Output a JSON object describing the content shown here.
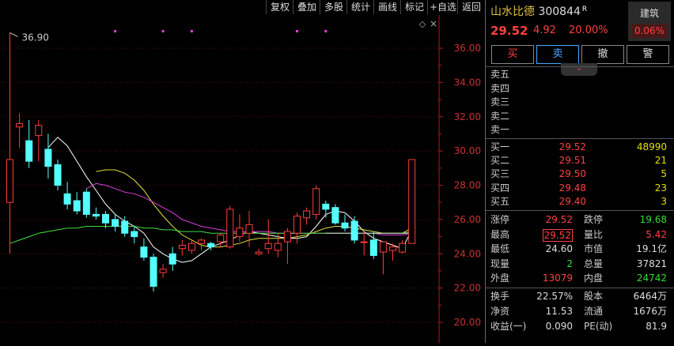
{
  "toolbar": {
    "buttons": [
      "复权",
      "叠加",
      "多股",
      "统计",
      "画线",
      "标记",
      "+自选",
      "返回"
    ]
  },
  "chart": {
    "y_ticks": [
      "36.00",
      "34.00",
      "32.00",
      "30.00",
      "28.00",
      "26.00",
      "24.00",
      "22.00",
      "20.00"
    ],
    "high_marker": "36.90",
    "diamond": "◇",
    "close_x": "×"
  },
  "chart_data": {
    "type": "candlestick",
    "ylim": [
      19.3,
      37.6
    ],
    "y_ticks": [
      36,
      34,
      32,
      30,
      28,
      26,
      24,
      22,
      20
    ],
    "candles": [
      [
        27.0,
        36.9,
        24.0,
        29.5
      ],
      [
        31.4,
        32.2,
        30.2,
        31.6
      ],
      [
        30.6,
        31.8,
        29.0,
        29.4
      ],
      [
        30.9,
        31.8,
        29.4,
        31.5
      ],
      [
        30.1,
        31.0,
        28.4,
        29.1
      ],
      [
        29.2,
        29.5,
        27.7,
        28.0
      ],
      [
        27.5,
        28.2,
        26.6,
        26.9
      ],
      [
        27.1,
        27.6,
        26.3,
        26.5
      ],
      [
        27.6,
        27.8,
        26.1,
        26.3
      ],
      [
        26.3,
        26.7,
        26.0,
        26.2
      ],
      [
        26.3,
        26.5,
        25.5,
        25.8
      ],
      [
        26.0,
        26.3,
        25.3,
        25.6
      ],
      [
        25.9,
        26.2,
        25.0,
        25.2
      ],
      [
        25.3,
        25.6,
        24.6,
        25.0
      ],
      [
        24.4,
        24.9,
        23.6,
        23.8
      ],
      [
        23.8,
        24.0,
        21.8,
        22.1
      ],
      [
        22.9,
        23.4,
        22.6,
        23.1
      ],
      [
        24.0,
        24.4,
        23.0,
        23.4
      ],
      [
        24.3,
        24.8,
        23.9,
        24.5
      ],
      [
        24.2,
        24.8,
        24.0,
        24.6
      ],
      [
        24.6,
        24.9,
        24.2,
        24.8
      ],
      [
        24.6,
        24.7,
        24.2,
        24.4
      ],
      [
        24.7,
        25.2,
        24.4,
        25.1
      ],
      [
        24.4,
        26.8,
        24.3,
        26.6
      ],
      [
        25.0,
        26.3,
        24.7,
        25.5
      ],
      [
        25.2,
        26.5,
        24.4,
        25.7
      ],
      [
        24.0,
        24.3,
        23.9,
        24.1
      ],
      [
        24.3,
        26.0,
        24.0,
        24.6
      ],
      [
        24.2,
        25.2,
        23.8,
        24.6
      ],
      [
        24.7,
        25.5,
        23.4,
        25.3
      ],
      [
        25.2,
        26.4,
        24.6,
        26.2
      ],
      [
        26.1,
        26.7,
        25.7,
        26.5
      ],
      [
        26.3,
        28.0,
        26.0,
        27.8
      ],
      [
        26.9,
        27.1,
        26.1,
        26.6
      ],
      [
        26.7,
        26.9,
        25.7,
        25.8
      ],
      [
        25.8,
        26.3,
        25.3,
        25.5
      ],
      [
        25.9,
        26.2,
        24.6,
        24.8
      ],
      [
        24.7,
        25.3,
        23.9,
        24.7
      ],
      [
        24.8,
        25.3,
        23.7,
        23.9
      ],
      [
        24.1,
        24.7,
        22.8,
        24.7
      ],
      [
        24.2,
        24.6,
        23.6,
        24.4
      ],
      [
        24.1,
        24.8,
        24.0,
        24.6
      ],
      [
        24.6,
        29.5,
        24.6,
        29.5
      ]
    ],
    "ma": [
      {
        "color": "#ffffff",
        "values": [
          null,
          null,
          null,
          null,
          30.2,
          30.8,
          30.3,
          29.4,
          28.5,
          27.7,
          26.9,
          26.3,
          25.9,
          25.6,
          25.2,
          24.4,
          24.0,
          23.7,
          23.5,
          23.6,
          24.0,
          24.4,
          24.6,
          24.8,
          25.1,
          25.3,
          25.2,
          25.1,
          25.0,
          24.9,
          24.9,
          25.0,
          25.6,
          26.3,
          26.5,
          26.4,
          25.9,
          25.3,
          24.9,
          24.7,
          24.5,
          24.3,
          25.4
        ]
      },
      {
        "color": "#e0e040",
        "values": [
          null,
          null,
          null,
          null,
          null,
          null,
          null,
          null,
          null,
          28.8,
          28.9,
          28.9,
          28.7,
          28.3,
          27.7,
          26.9,
          26.2,
          25.6,
          25.1,
          24.8,
          24.5,
          24.4,
          24.4,
          24.5,
          24.6,
          24.8,
          24.9,
          24.9,
          24.9,
          24.9,
          25.0,
          25.1,
          25.3,
          25.5,
          25.6,
          25.6,
          25.5,
          25.4,
          25.3,
          25.2,
          25.2,
          25.2,
          25.5
        ]
      },
      {
        "color": "#e040e0",
        "values": [
          null,
          null,
          null,
          null,
          null,
          null,
          null,
          null,
          27.8,
          28.1,
          28.0,
          27.8,
          27.6,
          27.5,
          27.3,
          27.0,
          26.7,
          26.4,
          26.0,
          25.8,
          25.6,
          25.5,
          25.4,
          25.3,
          25.3,
          25.3,
          25.3,
          25.3,
          25.2,
          25.2,
          25.2,
          25.2,
          25.2,
          25.2,
          25.2,
          25.2,
          25.2,
          25.2,
          25.2,
          25.1,
          25.1,
          25.1,
          25.2
        ]
      },
      {
        "color": "#40e040",
        "values": [
          24.6,
          24.8,
          25.0,
          25.2,
          25.3,
          25.4,
          25.5,
          25.5,
          25.6,
          25.6,
          25.6,
          25.6,
          25.6,
          25.6,
          25.5,
          25.5,
          25.4,
          25.4,
          25.3,
          25.3,
          25.3,
          25.2,
          25.2,
          25.2,
          25.2,
          25.2,
          25.2,
          25.2,
          25.2,
          25.2,
          25.2,
          25.2,
          25.2,
          25.2,
          25.2,
          25.2,
          25.2,
          25.2,
          25.2,
          25.2,
          25.2,
          25.2,
          25.3
        ]
      }
    ],
    "price_line": 25.2,
    "top_markers_x_index": [
      11,
      16,
      19,
      30,
      33
    ]
  },
  "panel": {
    "name": "山水比德",
    "code": "300844",
    "r_badge": "R",
    "price": "29.52",
    "change": "4.92",
    "change_pct": "20.00%",
    "sector_name": "建筑",
    "sector_pct": "0.06%",
    "trade_buttons": [
      "买",
      "卖",
      "撤",
      "警"
    ],
    "tab_arrow": "⌄",
    "asks": [
      {
        "label": "卖五"
      },
      {
        "label": "卖四"
      },
      {
        "label": "卖三"
      },
      {
        "label": "卖二"
      },
      {
        "label": "卖一"
      }
    ],
    "bids": [
      {
        "label": "买一",
        "price": "29.52",
        "vol": "48990"
      },
      {
        "label": "买二",
        "price": "29.51",
        "vol": "21"
      },
      {
        "label": "买三",
        "price": "29.50",
        "vol": "5"
      },
      {
        "label": "买四",
        "price": "29.48",
        "vol": "23"
      },
      {
        "label": "买五",
        "price": "29.40",
        "vol": "3"
      }
    ],
    "stats1": [
      {
        "l1": "涨停",
        "v1": "29.52",
        "l2": "跌停",
        "v2": "19.68"
      },
      {
        "l1": "最高",
        "v1": "29.52",
        "l2": "量比",
        "v2": "5.42"
      },
      {
        "l1": "最低",
        "v1": "24.60",
        "l2": "市值",
        "v2": "19.1亿"
      },
      {
        "l1": "现量",
        "v1": "2",
        "l2": "总量",
        "v2": "37821"
      },
      {
        "l1": "外盘",
        "v1": "13079",
        "l2": "内盘",
        "v2": "24742"
      }
    ],
    "stats2": [
      {
        "l1": "换手",
        "v1": "22.57%",
        "l2": "股本",
        "v2": "6464万"
      },
      {
        "l1": "净资",
        "v1": "11.53",
        "l2": "流通",
        "v2": "1676万"
      },
      {
        "l1": "收益(一)",
        "v1": "0.090",
        "l2": "PE(动)",
        "v2": "81.9"
      }
    ]
  }
}
